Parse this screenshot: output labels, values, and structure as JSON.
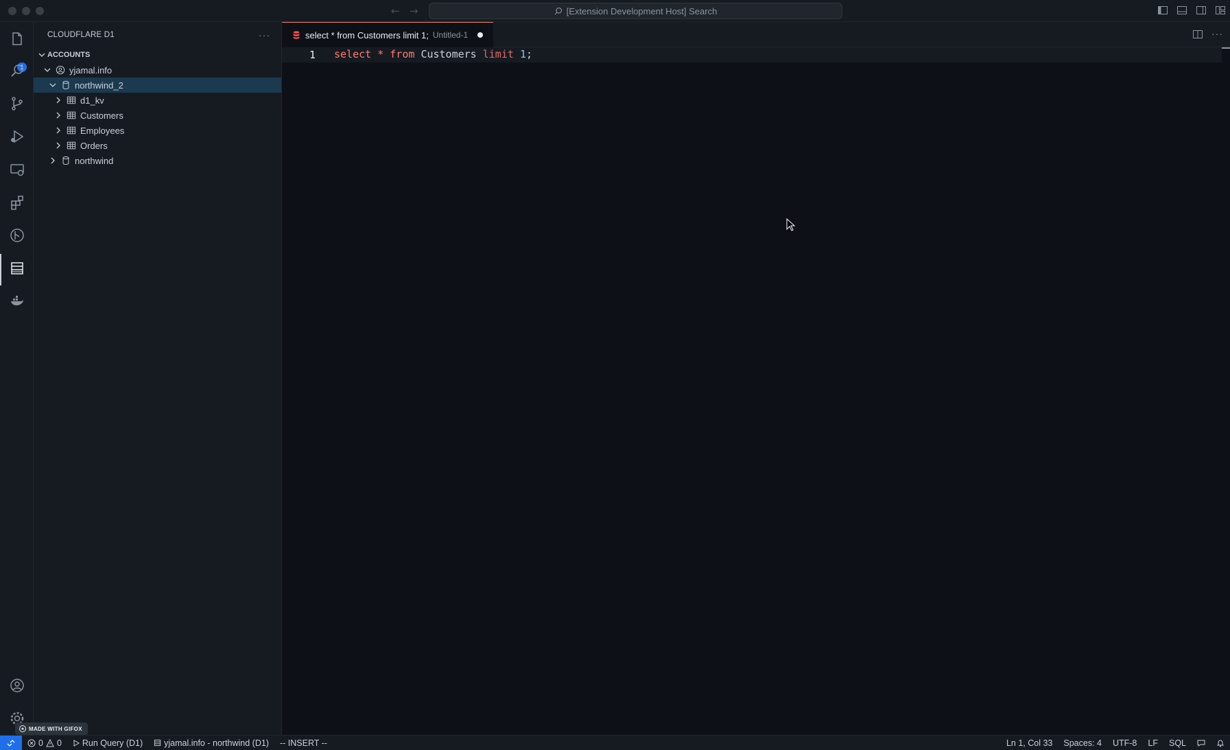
{
  "titlebar": {
    "search_text": "[Extension Development Host] Search"
  },
  "activity_bar": {
    "explorer_badge": "1",
    "items": [
      "files-icon",
      "search-icon",
      "source-control-icon",
      "run-debug-icon",
      "remote-explorer-icon",
      "extensions-icon",
      "git-graph-icon",
      "database-icon",
      "docker-icon"
    ],
    "bottom": [
      "account-icon",
      "settings-gear-icon"
    ]
  },
  "sidebar": {
    "title": "CLOUDFLARE D1",
    "section": "ACCOUNTS",
    "account": "yjamal.info",
    "database_open": "northwind_2",
    "tables": [
      "d1_kv",
      "Customers",
      "Employees",
      "Orders"
    ],
    "database_closed": "northwind"
  },
  "editor": {
    "tab_title": "select * from Customers limit 1;",
    "tab_desc": "Untitled-1",
    "line_number": "1",
    "code": {
      "kw_select": "select",
      "star": "*",
      "kw_from": "from",
      "table": "Customers",
      "kw_limit": "limit",
      "num": "1",
      "semi": ";"
    }
  },
  "statusbar": {
    "errors": "0",
    "warnings": "0",
    "run_query": "Run Query (D1)",
    "connection": "yjamal.info - northwind (D1)",
    "mode": "-- INSERT --",
    "position": "Ln 1, Col 33",
    "spaces": "Spaces: 4",
    "encoding": "UTF-8",
    "eol": "LF",
    "language": "SQL"
  },
  "overlay": {
    "gifox": "MADE WITH GIFOX"
  },
  "colors": {
    "accent_blue": "#1f6feb",
    "keyword_red": "#ff7b72",
    "selection": "#1c3a4f"
  }
}
